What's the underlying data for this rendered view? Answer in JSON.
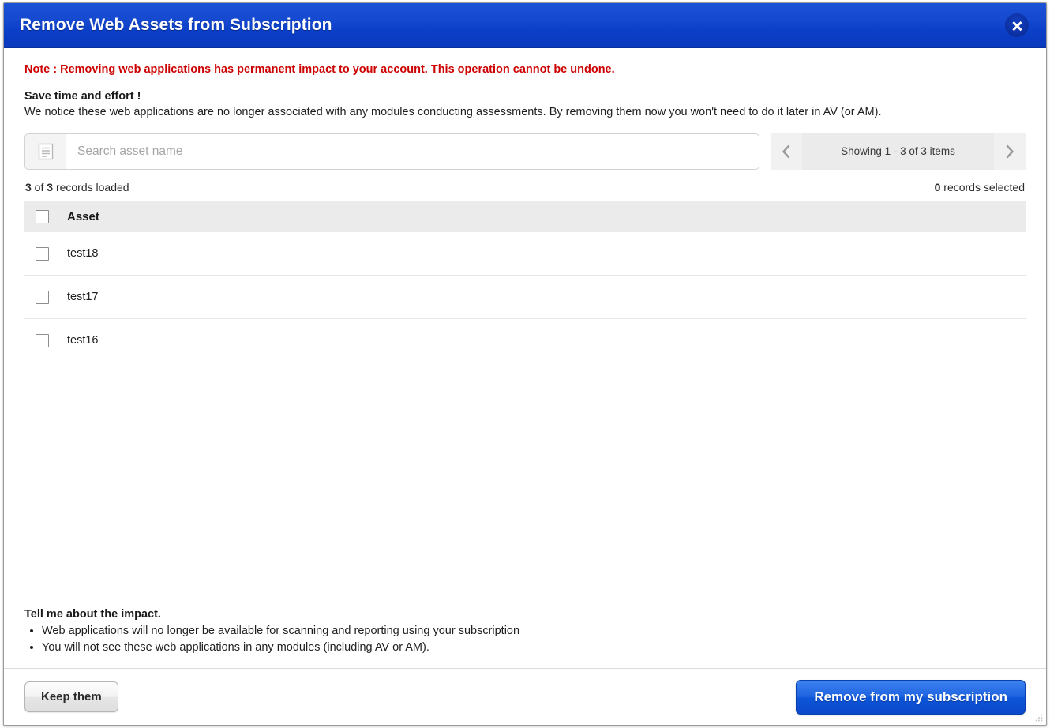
{
  "dialog": {
    "title": "Remove Web Assets from Subscription",
    "close_icon": "close-icon"
  },
  "note": "Note : Removing web applications has permanent impact to your account. This operation cannot be undone.",
  "save_section": {
    "heading": "Save time and effort !",
    "description": "We notice these web applications are no longer associated with any modules conducting assessments. By removing them now you won't need to do it later in AV (or AM)."
  },
  "search": {
    "placeholder": "Search asset name",
    "value": "",
    "icon": "list-lines-icon"
  },
  "pagination": {
    "prev_icon": "chevron-left-icon",
    "next_icon": "chevron-right-icon",
    "label": "Showing 1 - 3 of 3 items"
  },
  "counts": {
    "loaded_count": "3",
    "loaded_total": "3",
    "loaded_prefix": "",
    "loaded_mid": " of ",
    "loaded_suffix": " records loaded",
    "selected_count": "0",
    "selected_suffix": " records selected"
  },
  "table": {
    "header": {
      "column": "Asset"
    },
    "rows": [
      {
        "asset": "test18"
      },
      {
        "asset": "test17"
      },
      {
        "asset": "test16"
      }
    ]
  },
  "impact": {
    "heading": "Tell me about the impact.",
    "bullets": [
      "Web applications will no longer be available for scanning and reporting using your subscription",
      "You will not see these web applications in any modules (including AV or AM)."
    ]
  },
  "footer": {
    "keep_label": "Keep them",
    "remove_label": "Remove from my subscription"
  },
  "colors": {
    "title_bar_blue": "#0b3fc8",
    "note_red": "#cc0000",
    "primary_button_blue": "#1f63e0",
    "header_row_gray": "#ebebeb"
  }
}
